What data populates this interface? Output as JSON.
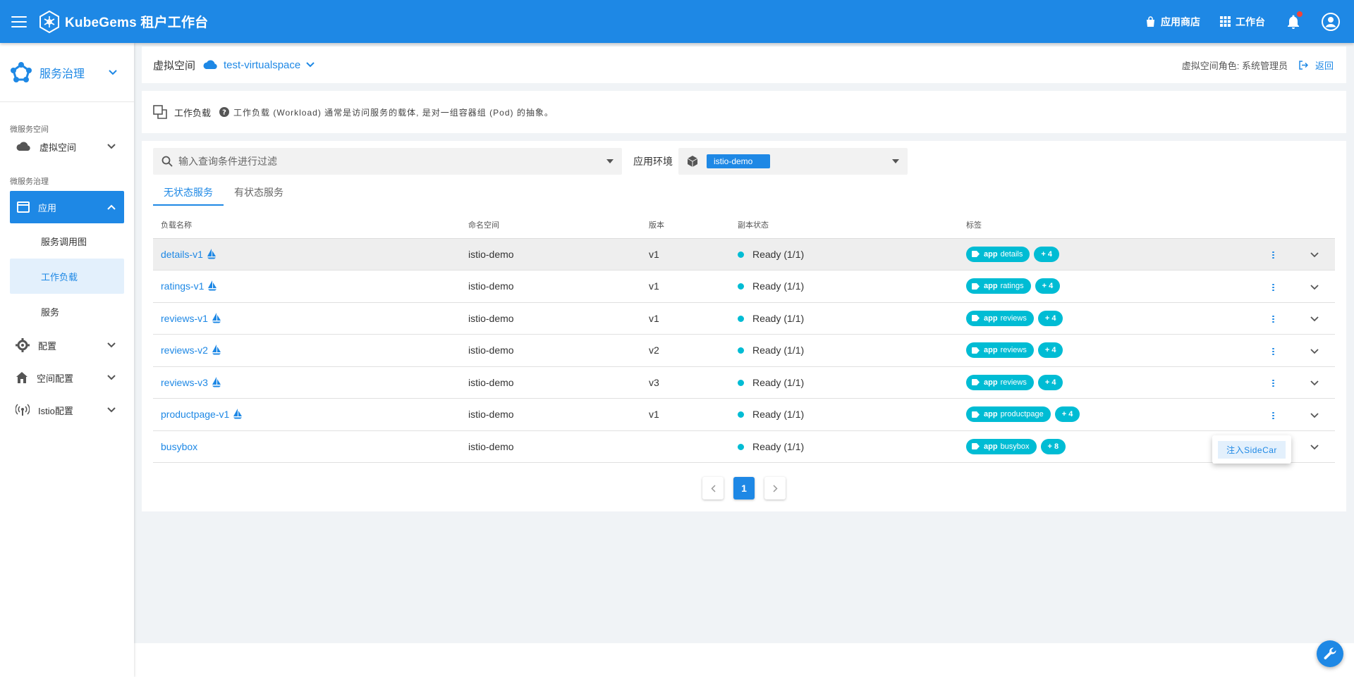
{
  "header": {
    "brand_name": "KubeGems 租户工作台",
    "app_store": "应用商店",
    "workspace": "工作台"
  },
  "sidebar": {
    "title": "服务治理",
    "section_micro_space": "微服务空间",
    "virtual_space": "虚拟空间",
    "section_governance": "微服务治理",
    "app": "应用",
    "sub_items": [
      "服务调用图",
      "工作负载",
      "服务"
    ],
    "config": "配置",
    "space_config": "空间配置",
    "istio_config": "Istio配置"
  },
  "namespace_bar": {
    "label": "虚拟空间",
    "value": "test-virtualspace",
    "role": "虚拟空间角色: 系统管理员",
    "back": "返回"
  },
  "description": {
    "title": "工作负载",
    "text": "工作负载 (Workload) 通常是访问服务的载体, 是对一组容器组 (Pod) 的抽象。"
  },
  "filter": {
    "search_placeholder": "输入查询条件进行过滤",
    "env_label": "应用环境",
    "env_value": "istio-demo"
  },
  "tabs": [
    "无状态服务",
    "有状态服务"
  ],
  "table": {
    "headers": [
      "负载名称",
      "命名空间",
      "版本",
      "副本状态",
      "标签"
    ],
    "rows": [
      {
        "name": "details-v1",
        "ns": "istio-demo",
        "version": "v1",
        "status": "Ready (1/1)",
        "label_key": "app",
        "label_val": "details",
        "more": "+ 4"
      },
      {
        "name": "ratings-v1",
        "ns": "istio-demo",
        "version": "v1",
        "status": "Ready (1/1)",
        "label_key": "app",
        "label_val": "ratings",
        "more": "+ 4"
      },
      {
        "name": "reviews-v1",
        "ns": "istio-demo",
        "version": "v1",
        "status": "Ready (1/1)",
        "label_key": "app",
        "label_val": "reviews",
        "more": "+ 4"
      },
      {
        "name": "reviews-v2",
        "ns": "istio-demo",
        "version": "v2",
        "status": "Ready (1/1)",
        "label_key": "app",
        "label_val": "reviews",
        "more": "+ 4"
      },
      {
        "name": "reviews-v3",
        "ns": "istio-demo",
        "version": "v3",
        "status": "Ready (1/1)",
        "label_key": "app",
        "label_val": "reviews",
        "more": "+ 4"
      },
      {
        "name": "productpage-v1",
        "ns": "istio-demo",
        "version": "v1",
        "status": "Ready (1/1)",
        "label_key": "app",
        "label_val": "productpage",
        "more": "+ 4"
      },
      {
        "name": "busybox",
        "ns": "istio-demo",
        "version": "",
        "status": "Ready (1/1)",
        "label_key": "app",
        "label_val": "busybox",
        "more": "+ 8"
      }
    ]
  },
  "pagination": {
    "current": "1"
  },
  "row_menu": {
    "inject": "注入SideCar"
  },
  "colors": {
    "primary": "#1e88e5",
    "chip": "#00bcd4",
    "notify": "#f44336"
  }
}
